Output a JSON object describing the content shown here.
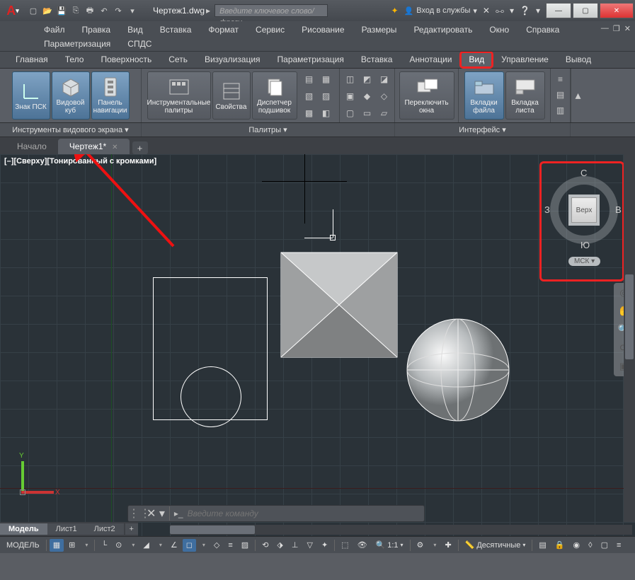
{
  "title": {
    "filename": "Чертеж1.dwg",
    "search_placeholder": "Введите ключевое слово/фразу",
    "signin": "Вход в службы"
  },
  "qat": [
    "new",
    "open",
    "save",
    "saveas",
    "print",
    "undo",
    "redo"
  ],
  "menubar": {
    "row1": [
      "Файл",
      "Правка",
      "Вид",
      "Вставка",
      "Формат",
      "Сервис",
      "Рисование",
      "Размеры",
      "Редактировать",
      "Окно",
      "Справка"
    ],
    "row2": [
      "Параметризация",
      "СПДС"
    ]
  },
  "ribbon_tabs": [
    "Главная",
    "Тело",
    "Поверхность",
    "Сеть",
    "Визуализация",
    "Параметризация",
    "Вставка",
    "Аннотации",
    "Вид",
    "Управление",
    "Вывод"
  ],
  "ribbon_active_tab": "Вид",
  "ribbon": {
    "panel1": {
      "title": "Инструменты видового экрана",
      "btns": [
        {
          "label": "Знак ПСК",
          "icon": "ucs-icon"
        },
        {
          "label": "Видовой куб",
          "icon": "viewcube-icon"
        },
        {
          "label": "Панель навигации",
          "icon": "navbar-icon"
        }
      ]
    },
    "panel2": {
      "title": "Палитры",
      "btns": [
        {
          "label": "Инструментальные палитры",
          "icon": "palette-icon"
        },
        {
          "label": "Свойства",
          "icon": "properties-icon"
        },
        {
          "label": "Диспетчер подшивок",
          "icon": "sheetset-icon"
        }
      ]
    },
    "panel3": {
      "title": "",
      "btns": [
        {
          "label": "Переключить окна",
          "icon": "switchwin-icon"
        }
      ]
    },
    "panel4": {
      "title": "Интерфейс",
      "btns": [
        {
          "label": "Вкладки файла",
          "icon": "filetabs-icon"
        },
        {
          "label": "Вкладка листа",
          "icon": "layouttabs-icon"
        }
      ]
    }
  },
  "filetabs": {
    "start": "Начало",
    "active": "Чертеж1*"
  },
  "view_label": "[–][Сверху][Тонированный с кромками]",
  "viewcube": {
    "top": "Верх",
    "n": "С",
    "s": "Ю",
    "e": "В",
    "w": "З",
    "coord": "МСК"
  },
  "ucs": {
    "x": "X",
    "y": "Y"
  },
  "command": {
    "placeholder": "Введите команду"
  },
  "layout_tabs": {
    "model": "Модель",
    "l1": "Лист1",
    "l2": "Лист2"
  },
  "status": {
    "model": "МОДЕЛЬ",
    "scale": "1:1",
    "units": "Десятичные"
  }
}
